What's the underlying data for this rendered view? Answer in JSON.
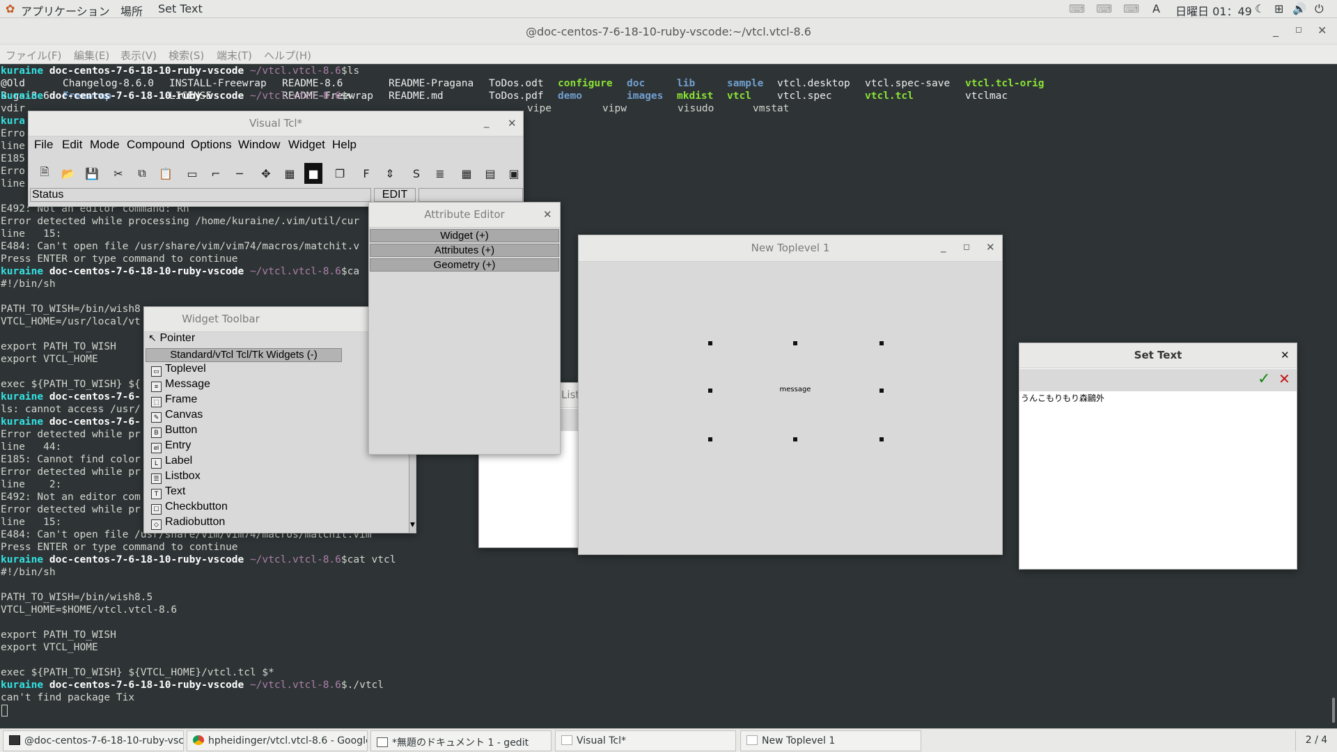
{
  "topbar": {
    "apps": "アプリケーション",
    "places": "場所",
    "active_app": "Set Text",
    "input_method": "A",
    "clock": "日曜日 01：49"
  },
  "terminal": {
    "title": "@doc-centos-7-6-18-10-ruby-vscode:~/vtcl.vtcl-8.6",
    "menu": [
      "ファイル(F)",
      "編集(E)",
      "表示(V)",
      "検索(S)",
      "端末(T)",
      "ヘルプ(H)"
    ],
    "prompt_user": "kuraine",
    "prompt_host": "doc-centos-7-6-18-10-ruby-vscode",
    "prompt_path": "~/vtcl.vtcl-8.6",
    "prompt_sign": "$",
    "ls_cmd": "ls",
    "ls_row1": [
      {
        "t": "@Old",
        "c": "cw"
      },
      {
        "t": "Changelog-8.6.0",
        "c": "cw"
      },
      {
        "t": "INSTALL-Freewrap",
        "c": "cw"
      },
      {
        "t": "README-8.6",
        "c": "cw"
      },
      {
        "t": "README-Pragana",
        "c": "cw"
      },
      {
        "t": "ToDos.odt",
        "c": "cw"
      },
      {
        "t": "configure",
        "c": "cg"
      },
      {
        "t": "doc",
        "c": "cb"
      },
      {
        "t": "lib",
        "c": "cb"
      },
      {
        "t": "sample",
        "c": "cb"
      },
      {
        "t": "vtcl.desktop",
        "c": "cw"
      },
      {
        "t": "vtcl.spec-save",
        "c": "cw"
      },
      {
        "t": "vtcl.tcl-orig",
        "c": "cg"
      }
    ],
    "ls_row2": [
      {
        "t": "Bugs-8.6",
        "c": "cw"
      },
      {
        "t": "Freewrap",
        "c": "cb"
      },
      {
        "t": "LICENSE",
        "c": "cw"
      },
      {
        "t": "README-Freewrap",
        "c": "cw"
      },
      {
        "t": "README.md",
        "c": "cw"
      },
      {
        "t": "ToDos.pdf",
        "c": "cw"
      },
      {
        "t": "demo",
        "c": "cb"
      },
      {
        "t": "images",
        "c": "cb"
      },
      {
        "t": "mkdist",
        "c": "cg"
      },
      {
        "t": "vtcl",
        "c": "cg"
      },
      {
        "t": "vtcl.spec",
        "c": "cw"
      },
      {
        "t": "vtcl.tcl",
        "c": "cg"
      },
      {
        "t": "vtclmac",
        "c": "cw"
      }
    ],
    "partial_prompt": "kuraine doc-centos-7-6-18-10-ruby-vscode ~/vtcl.vtcl-8.6$v",
    "v_completion": [
      "vdir",
      "vipe",
      "vipw",
      "visudo",
      "vmstat"
    ],
    "left_fragments": [
      "kura",
      "Erro",
      "line",
      "E185",
      "Erro",
      "line"
    ],
    "lines_a": [
      "E492: Not an editor command: Rn",
      "Error detected while processing /home/kuraine/.vim/util/cur",
      "line   15:",
      "E484: Can't open file /usr/share/vim/vim74/macros/matchit.v",
      "Press ENTER or type command to continue"
    ],
    "cmd_ca": "ca",
    "shebang": "#!/bin/sh",
    "path_to_wish_a": "PATH_TO_WISH=/bin/wish8",
    "vtcl_home_a": "VTCL_HOME=/usr/local/vt",
    "export1": "export PATH_TO_WISH",
    "export2": "export VTCL_HOME",
    "exec_a": "exec ${PATH_TO_WISH} ${",
    "prompt_frag": "kuraine doc-centos-7-6-",
    "ls_err": "ls: cannot access /usr/",
    "lines_b": [
      "Error detected while pr",
      "line   44:",
      "E185: Cannot find color",
      "Error detected while pr",
      "line    2:",
      "E492: Not an editor com",
      "Error detected while pr",
      "line   15:"
    ],
    "e484_full": "E484: Can't open file /usr/share/vim/vim74/macros/matchit.vim",
    "press_enter": "Press ENTER or type command to continue",
    "cmd_cat": "cat vtcl",
    "path_to_wish_b": "PATH_TO_WISH=/bin/wish8.5",
    "vtcl_home_b": "VTCL_HOME=$HOME/vtcl.vtcl-8.6",
    "exec_b": "exec ${PATH_TO_WISH} ${VTCL_HOME}/vtcl.tcl $*",
    "cmd_run": "./vtcl",
    "tix_err": "can't find package Tix"
  },
  "vtcl_main": {
    "title": "Visual Tcl*",
    "menu": [
      "File",
      "Edit",
      "Mode",
      "Compound",
      "Options",
      "Window",
      "Widget",
      "Help"
    ],
    "tools": [
      "new-file-icon",
      "open-folder-icon",
      "save-icon",
      "cut-icon",
      "copy-icon",
      "paste-icon",
      "toplevel-icon",
      "frame-icon",
      "separator-icon",
      "move-icon",
      "widget-tree-icon",
      "raise-icon",
      "lower-icon",
      "font-icon",
      "align-icon",
      "script-icon",
      "text-align-icon",
      "grid-icon",
      "layout-icon",
      "geometry-icon"
    ],
    "tool_glyphs": [
      "🗎",
      "📂",
      "💾",
      "✂",
      "⧉",
      "📋",
      "▭",
      "⌐",
      "─",
      "✥",
      "▦",
      "■",
      "❐",
      "F",
      "⇕",
      "S",
      "≣",
      "▦",
      "▤",
      "▣"
    ],
    "status": "Status",
    "mode": "EDIT"
  },
  "attribute_editor": {
    "title": "Attribute Editor",
    "sections": [
      "Widget (+)",
      "Attributes (+)",
      "Geometry (+)"
    ]
  },
  "widget_toolbar": {
    "title": "Widget Toolbar",
    "pointer": "Pointer",
    "group": "Standard/vTcl Tcl/Tk Widgets (-)",
    "items": [
      "Toplevel",
      "Message",
      "Frame",
      "Canvas",
      "Button",
      "Entry",
      "Label",
      "Listbox",
      "Text",
      "Checkbutton",
      "Radiobutton"
    ],
    "item_glyphs": [
      "▭",
      "≡",
      "⬚",
      "✎",
      "B",
      "el",
      "L",
      "☰",
      "T",
      "☐",
      "◇"
    ]
  },
  "list_window": {
    "title": "List"
  },
  "new_toplevel": {
    "title": "New Toplevel 1",
    "widget_text": "message"
  },
  "set_text": {
    "title": "Set Text",
    "content": "うんこもりもり森鷗外"
  },
  "taskbar": {
    "tasks": [
      "@doc-centos-7-6-18-10-ruby-vsco…",
      "hpheidinger/vtcl.vtcl-8.6 - Google C…",
      "*無題のドキュメント 1 - gedit",
      "Visual Tcl*",
      "New Toplevel 1"
    ],
    "workspace": "2 / 4"
  }
}
